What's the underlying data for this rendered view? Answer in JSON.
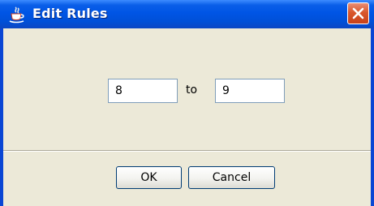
{
  "window": {
    "title": "Edit Rules",
    "app_icon": "java-cup-icon",
    "close_icon": "close-icon"
  },
  "form": {
    "from_value": "8",
    "connector_label": "to",
    "to_value": "9"
  },
  "buttons": {
    "ok_label": "OK",
    "cancel_label": "Cancel"
  },
  "colors": {
    "titlebar": "#0055e5",
    "window_background": "#ece9d8",
    "close_button": "#d9572c",
    "field_border": "#7f9db9",
    "button_border": "#003c74"
  }
}
